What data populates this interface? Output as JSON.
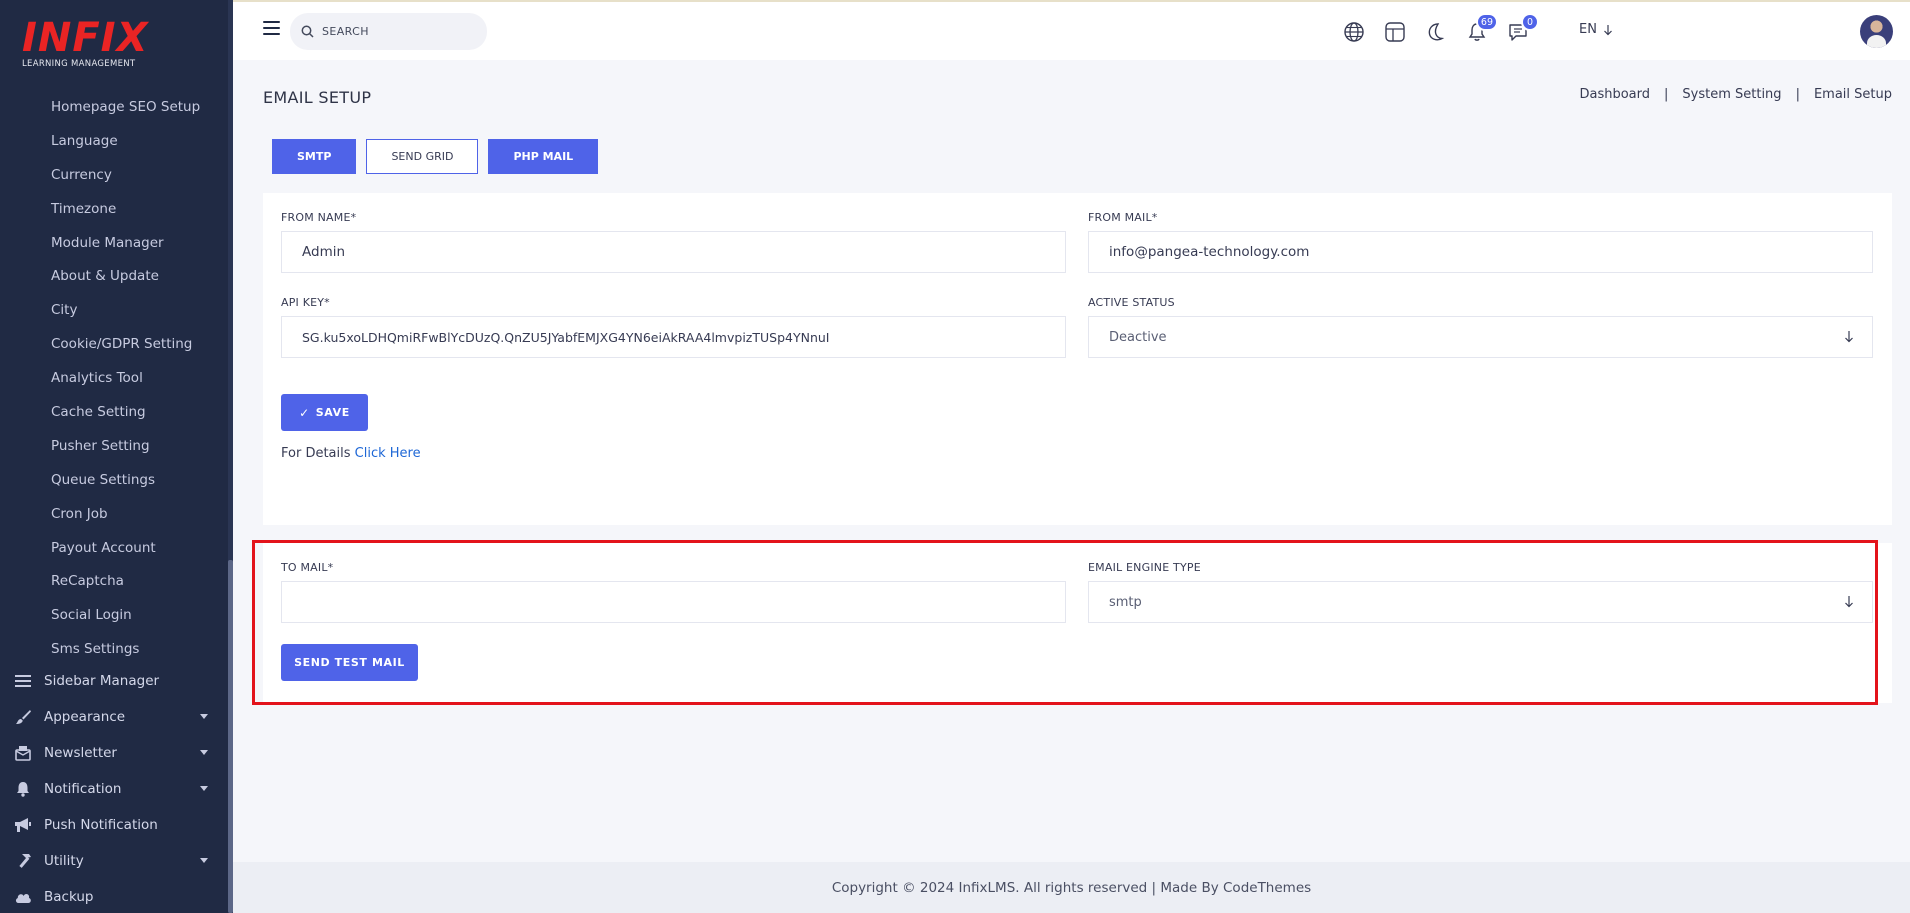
{
  "brand": {
    "logo_text": "INFIX",
    "logo_sub": "LEARNING MANAGEMENT"
  },
  "sidebar": {
    "sub_items": [
      "Homepage SEO Setup",
      "Language",
      "Currency",
      "Timezone",
      "Module Manager",
      "About & Update",
      "City",
      "Cookie/GDPR Setting",
      "Analytics Tool",
      "Cache Setting",
      "Pusher Setting",
      "Queue Settings",
      "Cron Job",
      "Payout Account",
      "ReCaptcha",
      "Social Login",
      "Sms Settings"
    ],
    "menu": [
      {
        "label": "Sidebar Manager",
        "icon": "list-icon"
      },
      {
        "label": "Appearance",
        "icon": "brush-icon"
      },
      {
        "label": "Newsletter",
        "icon": "newsletter-icon"
      },
      {
        "label": "Notification",
        "icon": "bell-icon"
      },
      {
        "label": "Push Notification",
        "icon": "megaphone-icon"
      },
      {
        "label": "Utility",
        "icon": "hammer-icon"
      },
      {
        "label": "Backup",
        "icon": "cloud-icon"
      }
    ]
  },
  "header": {
    "search_placeholder": "SEARCH",
    "lang": "EN",
    "notifications_count": "69",
    "messages_count": "0"
  },
  "page": {
    "title": "EMAIL SETUP",
    "breadcrumb": [
      "Dashboard",
      "System Setting",
      "Email Setup"
    ],
    "tabs": [
      "SMTP",
      "SEND GRID",
      "PHP MAIL"
    ]
  },
  "form": {
    "from_name_label": "FROM NAME*",
    "from_name_value": "Admin",
    "from_mail_label": "FROM MAIL*",
    "from_mail_value": "info@pangea-technology.com",
    "api_key_label": "API KEY*",
    "api_key_value": "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",
    "active_status_label": "ACTIVE STATUS",
    "active_status_value": "Deactive",
    "save_label": "SAVE",
    "details_text": "For Details",
    "details_link": "Click Here"
  },
  "test": {
    "to_mail_label": "TO MAIL*",
    "to_mail_value": "",
    "engine_label": "EMAIL ENGINE TYPE",
    "engine_value": "smtp",
    "send_label": "SEND TEST MAIL"
  },
  "footer": {
    "text": "Copyright © 2024 InfixLMS. All rights reserved | Made By CodeThemes"
  },
  "colors": {
    "accent": "#4f63e8",
    "sidebar": "#202a44",
    "highlight": "#e3131b",
    "brand": "#ea2424"
  }
}
